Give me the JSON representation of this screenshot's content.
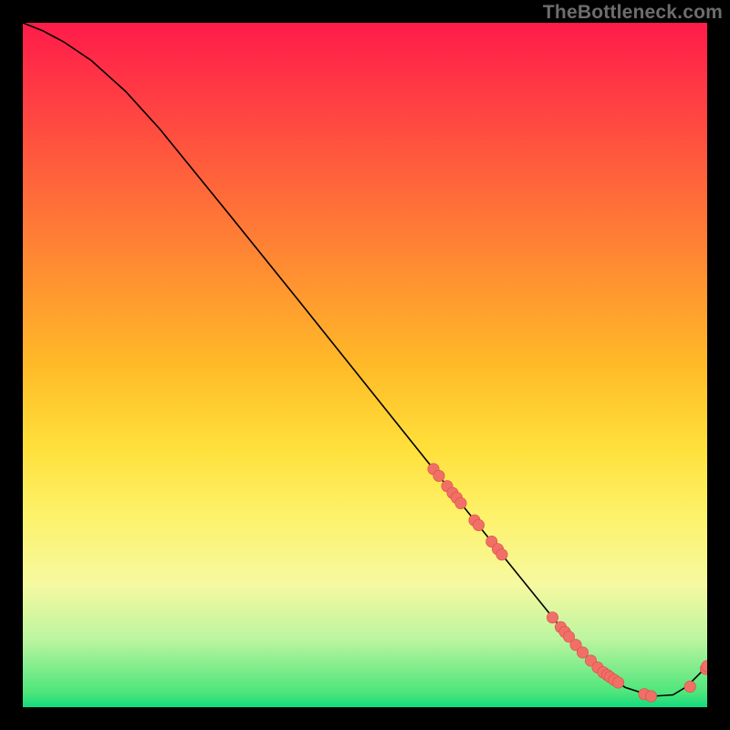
{
  "watermark": "TheBottleneck.com",
  "colors": {
    "frame_bg": "#000000",
    "dot_fill": "#f07068",
    "dot_stroke": "#e04a45",
    "curve": "#000000"
  },
  "chart_data": {
    "type": "line",
    "title": "",
    "xlabel": "",
    "ylabel": "",
    "xlim": [
      0,
      100
    ],
    "ylim": [
      0,
      100
    ],
    "curve": {
      "x": [
        0,
        3,
        6,
        10,
        15,
        20,
        30,
        40,
        50,
        60,
        70,
        78,
        84,
        88,
        92,
        95,
        97,
        100
      ],
      "y": [
        100,
        98.8,
        97.2,
        94.5,
        90.0,
        84.5,
        72.2,
        59.8,
        47.3,
        34.8,
        22.3,
        12.4,
        5.8,
        2.9,
        1.6,
        1.8,
        3.0,
        6.0
      ]
    },
    "series": [
      {
        "name": "points",
        "x": [
          60.0,
          60.8,
          62.0,
          62.8,
          63.4,
          64.0,
          66.0,
          66.6,
          68.5,
          69.4,
          70.0,
          77.4,
          78.6,
          79.2,
          79.8,
          80.8,
          81.8,
          83.0,
          84.0,
          84.8,
          85.4,
          85.8,
          86.4,
          87.0,
          90.8,
          91.8,
          97.5,
          99.8,
          100.0
        ],
        "y": [
          34.8,
          33.8,
          32.3,
          31.3,
          30.6,
          29.8,
          27.3,
          26.6,
          24.2,
          23.1,
          22.3,
          13.1,
          11.7,
          11.0,
          10.3,
          9.1,
          8.0,
          6.8,
          5.8,
          5.1,
          4.7,
          4.4,
          4.0,
          3.6,
          1.9,
          1.6,
          3.0,
          5.6,
          6.0
        ]
      }
    ]
  }
}
